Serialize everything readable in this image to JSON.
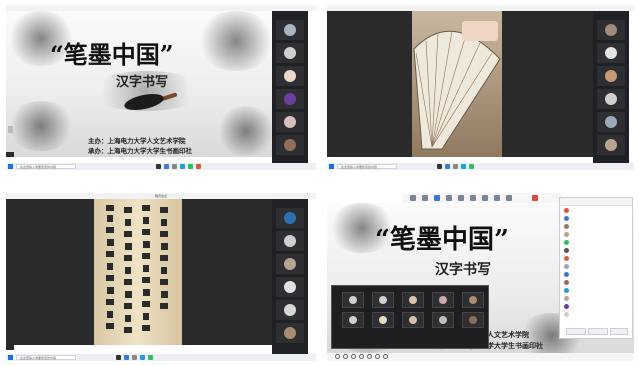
{
  "window_titles": [
    "",
    "",
    "腾讯会议",
    ""
  ],
  "taskbar_search_placeholder": "在这里输入你要搜索的内容",
  "slide": {
    "title": "“笔墨中国”",
    "subtitle": "汉字书写",
    "host_line": "主办：上海电力大学人文艺术学院",
    "organizer_line": "承办：上海电力大学大学生书画印社"
  },
  "quad4": {
    "title": "“笔墨中国”",
    "subtitle": "汉字书写",
    "partial_line_1": "人文艺术学院",
    "partial_line_2": "承办：上海电力大学大学生书画印社"
  },
  "calligraphy_text": "龍門雨脚風花鶴家清天聞夜深柳",
  "accent_colors": {
    "taskbar": "#eceff3",
    "sidebar": "#202124",
    "win_logo": "#1e6fd9"
  }
}
